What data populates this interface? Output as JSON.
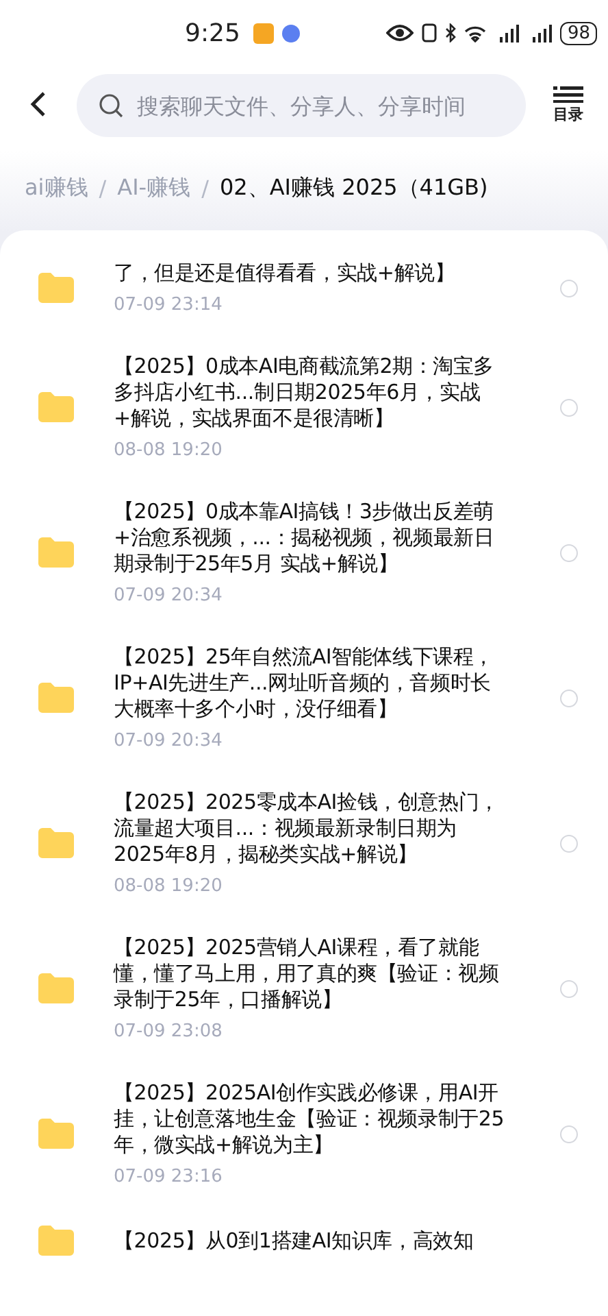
{
  "status_bar": {
    "time": "9:25",
    "battery": "98"
  },
  "header": {
    "search": {
      "placeholder": "搜索聊天文件、分享人、分享时间"
    },
    "toc_label": "目录"
  },
  "breadcrumb_separator": "/",
  "breadcrumb": [
    {
      "label": "ai赚钱",
      "selected": false
    },
    {
      "label": "AI-赚钱",
      "selected": false
    },
    {
      "label": "02、AI赚钱 2025（41GB)",
      "selected": true
    }
  ],
  "files": [
    {
      "title": "了，但是还是值得看看，实战+解说】",
      "time": "07-09  23:14",
      "selected": false
    },
    {
      "title": "【2025】0成本AI电商截流第2期：淘宝多多抖店小红书...制日期2025年6月，实战+解说，实战界面不是很清晰】",
      "time": "08-08  19:20",
      "selected": false
    },
    {
      "title": "【2025】0成本靠AI搞钱！3步做出反差萌+治愈系视频，...：揭秘视频，视频最新日期录制于25年5月 实战+解说】",
      "time": "07-09  20:34",
      "selected": false
    },
    {
      "title": "【2025】25年自然流AI智能体线下课程，IP+AI先进生产...网址听音频的，音频时长大概率十多个小时，没仔细看】",
      "time": "07-09  20:34",
      "selected": false
    },
    {
      "title": "【2025】2025零成本AI捡钱，创意热门，流量超大项目...：视频最新录制日期为2025年8月，揭秘类实战+解说】",
      "time": "08-08  19:20",
      "selected": false
    },
    {
      "title": "【2025】2025营销人AI课程，看了就能懂，懂了马上用，用了真的爽【验证：视频录制于25年，口播解说】",
      "time": "07-09  23:08",
      "selected": false
    },
    {
      "title": "【2025】2025AI创作实践必修课，用AI开挂，让创意落地生金【验证：视频录制于25年，微实战+解说为主】",
      "time": "07-09  23:16",
      "selected": false
    },
    {
      "title": "【2025】从0到1搭建AI知识库，高效知"
    }
  ]
}
